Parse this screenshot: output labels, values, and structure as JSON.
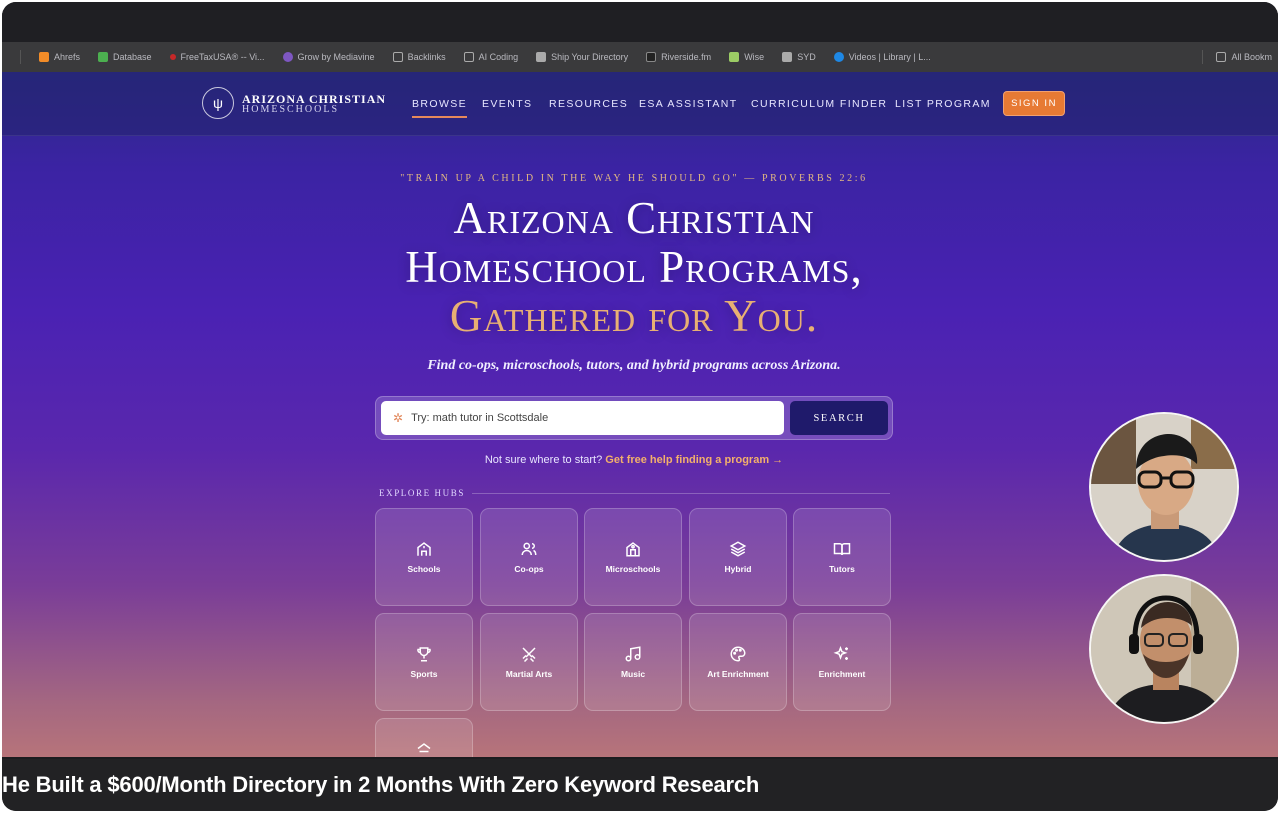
{
  "bookmarks": [
    {
      "label": "Ahrefs",
      "color": "#f28c28"
    },
    {
      "label": "Database",
      "color": "#4caf50"
    },
    {
      "label": "FreeTaxUSA® -- Vi...",
      "color": "#c62828"
    },
    {
      "label": "Grow by Mediavine",
      "color": "#7e57c2"
    },
    {
      "label": "Backlinks",
      "color": "#8a8a8a"
    },
    {
      "label": "AI Coding",
      "color": "#8a8a8a"
    },
    {
      "label": "Ship Your Directory",
      "color": "#aaaaaa"
    },
    {
      "label": "Riverside.fm",
      "color": "#222222"
    },
    {
      "label": "Wise",
      "color": "#9ccc65"
    },
    {
      "label": "SYD",
      "color": "#aaaaaa"
    },
    {
      "label": "Videos | Library | L...",
      "color": "#1e88e5"
    }
  ],
  "all_bookmarks": "All Bookm",
  "site": {
    "logo_line1": "ARIZONA CHRISTIAN",
    "logo_line2": "HOMESCHOOLS",
    "nav": [
      "BROWSE",
      "EVENTS",
      "RESOURCES",
      "ESA ASSISTANT",
      "CURRICULUM FINDER",
      "LIST PROGRAM"
    ],
    "sign_in": "SIGN IN",
    "verse": "\"TRAIN UP A CHILD IN THE WAY HE SHOULD GO\" — PROVERBS 22:6",
    "headline_1": "Arizona Christian",
    "headline_2": "Homeschool Programs,",
    "headline_3": "Gathered for You.",
    "tagline": "Find co-ops, microschools, tutors, and hybrid programs across Arizona.",
    "search_placeholder": "Try: math tutor in Scottsdale",
    "search_button": "SEARCH",
    "help_text": "Not sure where to start?",
    "help_link": "Get free help finding a program →",
    "hubs_label": "EXPLORE HUBS",
    "hubs": [
      "Schools",
      "Co-ops",
      "Microschools",
      "Hybrid",
      "Tutors",
      "Sports",
      "Martial Arts",
      "Music",
      "Art Enrichment",
      "Enrichment"
    ]
  },
  "caption": "He Built a $600/Month Directory in 2 Months With Zero Keyword Research",
  "colors": {
    "accent": "#e77a34",
    "gold": "#e8b073",
    "navy": "#1f1a6b"
  }
}
